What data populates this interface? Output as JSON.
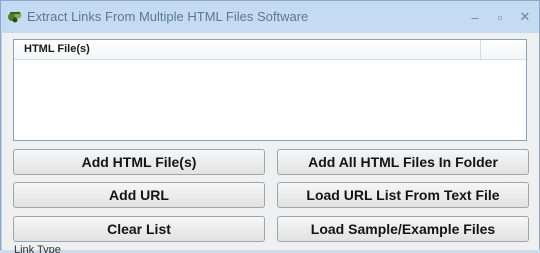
{
  "window": {
    "title": "Extract Links From Multiple HTML Files Software",
    "controls": {
      "minimize": "–",
      "maximize": "▫",
      "close": "✕"
    }
  },
  "file_list": {
    "columns": [
      "HTML File(s)"
    ],
    "rows": []
  },
  "buttons": {
    "add_html_files": "Add HTML File(s)",
    "add_all_html_in_folder": "Add All HTML Files In Folder",
    "add_url": "Add URL",
    "load_url_list": "Load URL List From Text File",
    "clear_list": "Clear List",
    "load_sample_files": "Load Sample/Example Files"
  },
  "footer": {
    "partial_label": "Link Type"
  },
  "colors": {
    "titlebar": "#c4dbf1",
    "client": "#f0f0f0",
    "accent": "#82a5c6"
  }
}
